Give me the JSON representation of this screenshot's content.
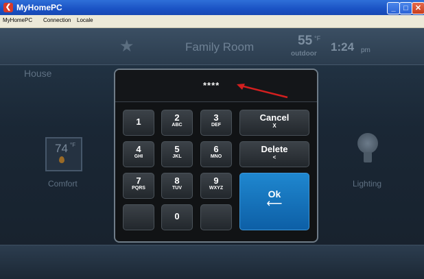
{
  "window": {
    "title": "MyHomePC",
    "app_icon": "app-logo-icon",
    "buttons": {
      "minimize": "_",
      "maximize": "□",
      "close": "✕"
    }
  },
  "menu": [
    "MyHomePC",
    "Connection",
    "Locale"
  ],
  "topbar": {
    "room": "Family Room",
    "outdoor_temp": "55",
    "temp_unit": "°F",
    "outdoor_label": "outdoor",
    "time": "1:24",
    "ampm": "pm",
    "star_icon": "star-icon"
  },
  "house_label": "House",
  "comfort": {
    "temp": "74",
    "unit": "°F",
    "label": "Comfort"
  },
  "lighting": {
    "label": "Lighting"
  },
  "keypad": {
    "pin_display": "****",
    "keys": [
      {
        "num": "1",
        "sub": ""
      },
      {
        "num": "2",
        "sub": "ABC"
      },
      {
        "num": "3",
        "sub": "DEF"
      },
      {
        "num": "4",
        "sub": "GHI"
      },
      {
        "num": "5",
        "sub": "JKL"
      },
      {
        "num": "6",
        "sub": "MNO"
      },
      {
        "num": "7",
        "sub": "PQRS"
      },
      {
        "num": "8",
        "sub": "TUV"
      },
      {
        "num": "9",
        "sub": "WXYZ"
      },
      {
        "num": "",
        "sub": ""
      },
      {
        "num": "0",
        "sub": ""
      },
      {
        "num": "",
        "sub": ""
      }
    ],
    "cancel": {
      "label": "Cancel",
      "sub": "X"
    },
    "delete": {
      "label": "Delete",
      "sub": "<"
    },
    "ok": {
      "label": "Ok",
      "sub": "⟵"
    }
  },
  "colors": {
    "accent": "#1677c4",
    "annotation_arrow": "#d31f1f"
  }
}
